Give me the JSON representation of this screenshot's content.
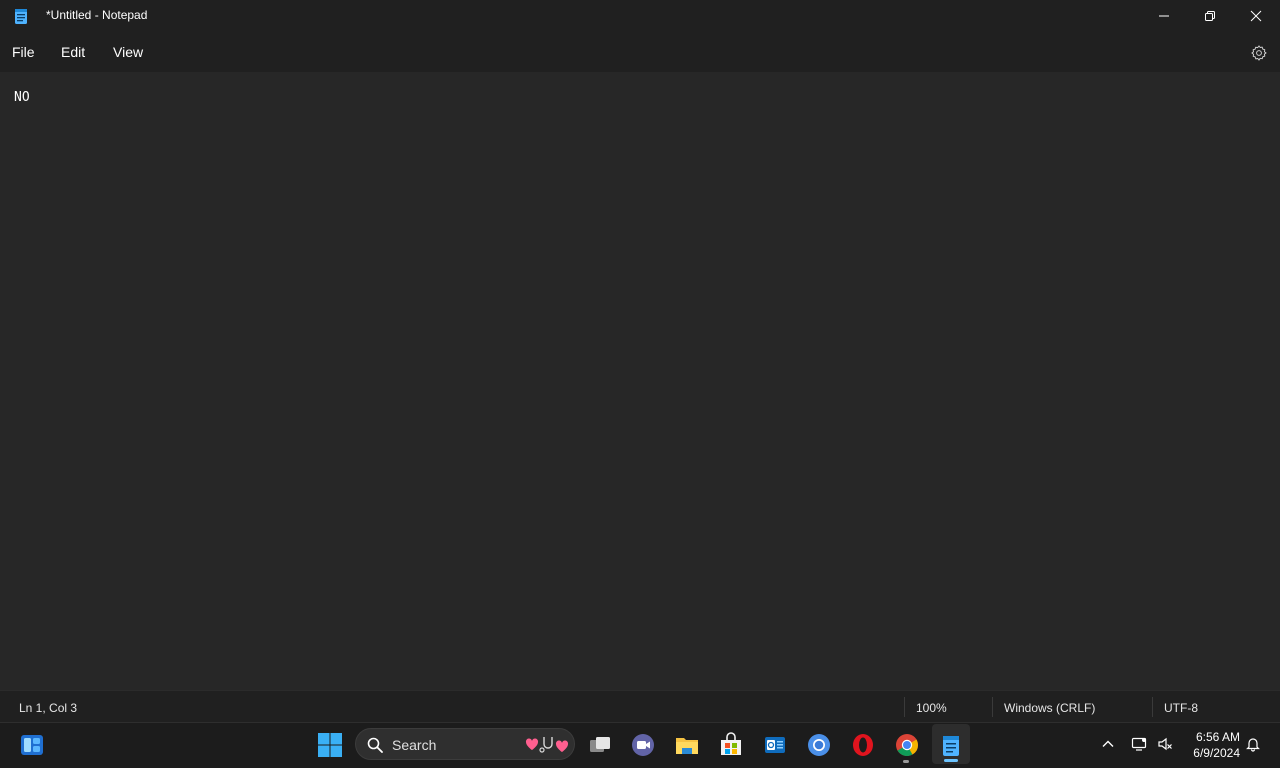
{
  "window": {
    "title": "*Untitled - Notepad"
  },
  "menu": {
    "file": "File",
    "edit": "Edit",
    "view": "View"
  },
  "editor": {
    "content": "NO"
  },
  "status": {
    "position": "Ln 1, Col 3",
    "zoom": "100%",
    "line_ending": "Windows (CRLF)",
    "encoding": "UTF-8"
  },
  "taskbar": {
    "search_label": "Search",
    "pinned_apps": [
      "widgets-icon",
      "start-icon",
      "task-view-icon",
      "teams-icon",
      "file-explorer-icon",
      "microsoft-store-icon",
      "outlook-icon",
      "chromium-icon",
      "opera-icon",
      "chrome-icon",
      "notepad-icon"
    ],
    "clock_time": "6:56 AM",
    "clock_date": "6/9/2024"
  },
  "colors": {
    "accent": "#6cc4ff",
    "editor_bg": "#272727",
    "chrome_bg": "#202020",
    "taskbar_bg": "#1c1c1c"
  }
}
